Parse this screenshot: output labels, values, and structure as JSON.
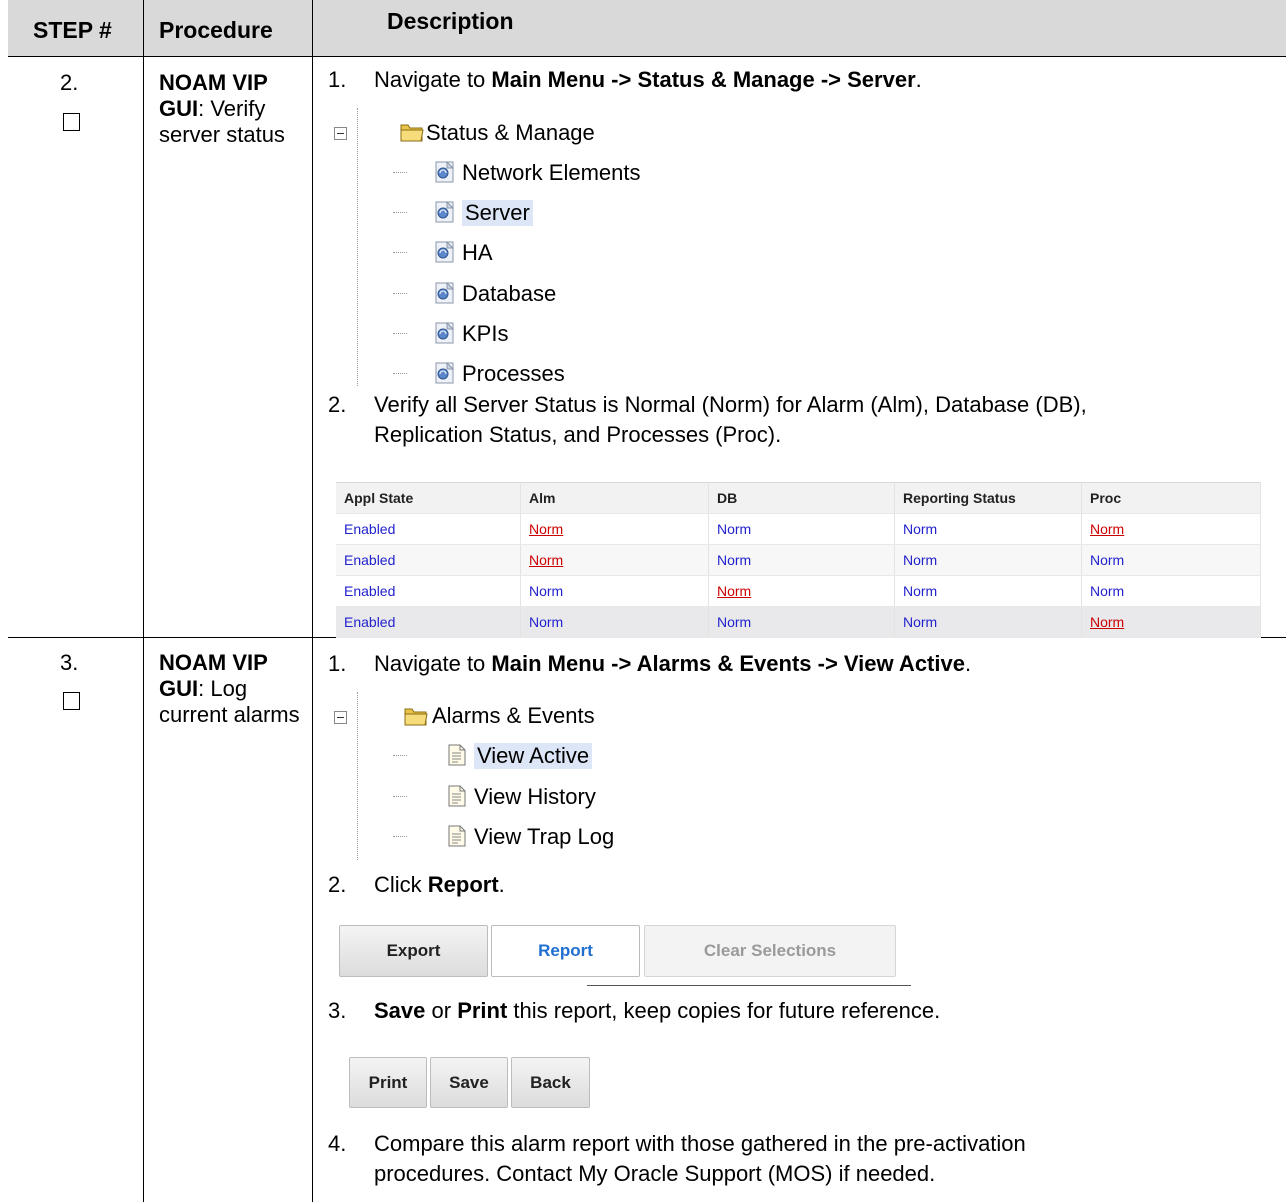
{
  "header": {
    "step": "STEP #",
    "procedure": "Procedure",
    "description": "Description"
  },
  "steps": [
    {
      "number": "2.",
      "proc_bold": "NOAM VIP GUI",
      "proc_rest": ": Verify server status",
      "items": [
        {
          "num": "1.",
          "pre": "Navigate to ",
          "bold": "Main Menu -> Status & Manage -> Server",
          "post": "."
        },
        {
          "num": "2.",
          "line1": "Verify all Server Status is Normal (Norm) for Alarm (Alm),  Database (DB),",
          "line2": "Replication Status, and Processes (Proc)."
        }
      ],
      "tree": {
        "root": "Status & Manage",
        "children": [
          "Network Elements",
          "Server",
          "HA",
          "Database",
          "KPIs",
          "Processes"
        ],
        "selected": "Server"
      },
      "table": {
        "columns": [
          "Appl State",
          "Alm",
          "DB",
          "Reporting Status",
          "Proc"
        ],
        "rows": [
          [
            "Enabled",
            "Norm",
            "Norm",
            "Norm",
            "Norm"
          ],
          [
            "Enabled",
            "Norm",
            "Norm",
            "Norm",
            "Norm"
          ],
          [
            "Enabled",
            "Norm",
            "Norm",
            "Norm",
            "Norm"
          ],
          [
            "Enabled",
            "Norm",
            "Norm",
            "Norm",
            "Norm"
          ]
        ]
      }
    },
    {
      "number": "3.",
      "proc_bold": "NOAM VIP GUI",
      "proc_rest": ": Log current alarms",
      "items": [
        {
          "num": "1.",
          "pre": "Navigate to ",
          "bold": "Main Menu -> Alarms & Events -> View Active",
          "post": "."
        },
        {
          "num": "2.",
          "pre": "Click ",
          "bold": "Report",
          "post": "."
        },
        {
          "num": "3.",
          "bold1": "Save",
          "mid": " or ",
          "bold2": "Print",
          "post": " this report, keep copies for future reference."
        },
        {
          "num": "4.",
          "line1": "Compare this alarm report with those gathered in the pre-activation",
          "line2": "procedures. Contact My Oracle Support (MOS) if needed."
        }
      ],
      "tree": {
        "root": "Alarms & Events",
        "children": [
          "View Active",
          "View History",
          "View Trap Log"
        ],
        "selected": "View Active"
      },
      "buttons_row1": [
        "Export",
        "Report",
        "Clear Selections"
      ],
      "buttons_row2": [
        "Print",
        "Save",
        "Back"
      ]
    }
  ]
}
